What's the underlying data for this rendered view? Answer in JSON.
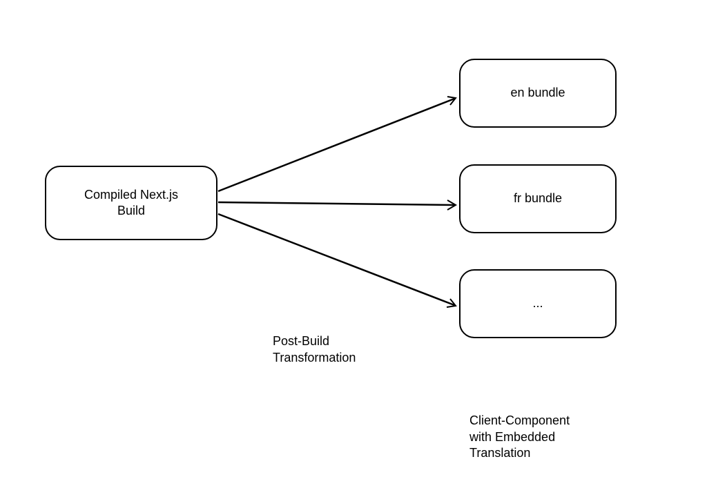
{
  "source_box": {
    "label": "Compiled Next.js\nBuild"
  },
  "targets": [
    {
      "label": "en bundle"
    },
    {
      "label": "fr bundle"
    },
    {
      "label": "..."
    }
  ],
  "center_label": "Post-Build\nTransformation",
  "right_label": "Client-Component\nwith Embedded\nTranslation"
}
